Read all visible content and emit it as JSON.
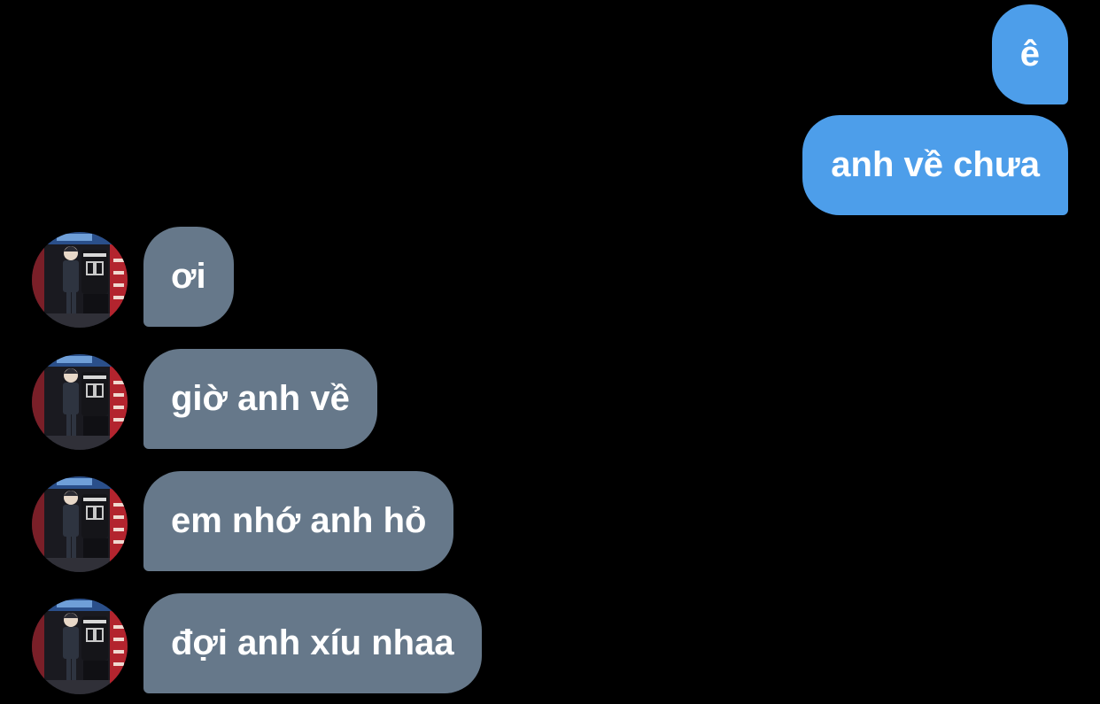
{
  "chat": {
    "sent_messages": [
      {
        "text": "ê"
      },
      {
        "text": "anh về chưa"
      }
    ],
    "received_messages": [
      {
        "text": "ơi"
      },
      {
        "text": "giờ anh về"
      },
      {
        "text": "em nhớ anh hỏ"
      },
      {
        "text": "đợi anh xíu nhaa"
      }
    ],
    "avatar": {
      "icon": "profile-photo-avatar"
    }
  },
  "colors": {
    "background": "#000000",
    "sent_bubble": "#4d9eea",
    "received_bubble": "#66788a",
    "text": "#ffffff"
  }
}
